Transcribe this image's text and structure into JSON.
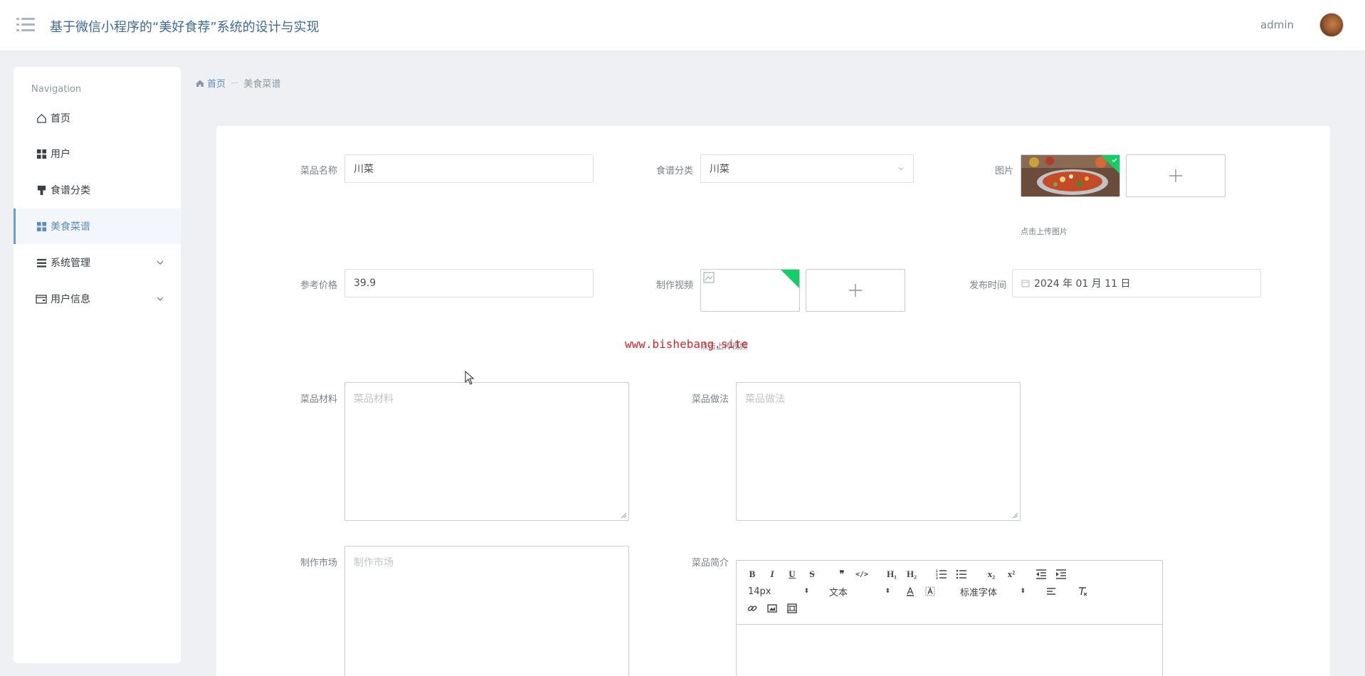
{
  "header": {
    "title": "基于微信小程序的“美好食荐”系统的设计与实现",
    "username": "admin"
  },
  "sidebar": {
    "caption": "Navigation",
    "items": [
      {
        "label": "首页",
        "icon": "home-icon"
      },
      {
        "label": "用户",
        "icon": "grid-icon"
      },
      {
        "label": "食谱分类",
        "icon": "brush-icon"
      },
      {
        "label": "美食菜谱",
        "icon": "grid-icon",
        "active": true
      },
      {
        "label": "系统管理",
        "icon": "list-icon",
        "expandable": true
      },
      {
        "label": "用户信息",
        "icon": "card-icon",
        "expandable": true
      }
    ]
  },
  "breadcrumb": {
    "home": "首页",
    "separator": "--",
    "current": "美食菜谱"
  },
  "form": {
    "name": {
      "label": "菜品名称",
      "value": "川菜"
    },
    "category": {
      "label": "食谱分类",
      "value": "川菜"
    },
    "image": {
      "label": "图片",
      "hint": "点击上传图片"
    },
    "price": {
      "label": "参考价格",
      "value": "39.9"
    },
    "video": {
      "label": "制作视频",
      "hint": "点击上传视频"
    },
    "publish_time": {
      "label": "发布时间",
      "value": "2024 年 01 月 11 日"
    },
    "ingredients": {
      "label": "菜品材料",
      "placeholder": "菜品材料"
    },
    "method": {
      "label": "菜品做法",
      "placeholder": "菜品做法"
    },
    "market": {
      "label": "制作市场",
      "placeholder": "制作市场"
    },
    "intro": {
      "label": "菜品简介"
    }
  },
  "editor": {
    "font_size": "14px",
    "header_select": "文本",
    "font_family": "标准字体",
    "buttons_row1": [
      "B",
      "I",
      "U",
      "S",
      "❞",
      "</>",
      "H₁",
      "H₂",
      "ol",
      "ul",
      "x₂",
      "x²",
      "outdent",
      "indent"
    ]
  },
  "watermark": "www.bishebang.site",
  "colors": {
    "accent": "#5b8cc0",
    "upload_success": "#13ce66",
    "watermark": "#d4252b"
  }
}
